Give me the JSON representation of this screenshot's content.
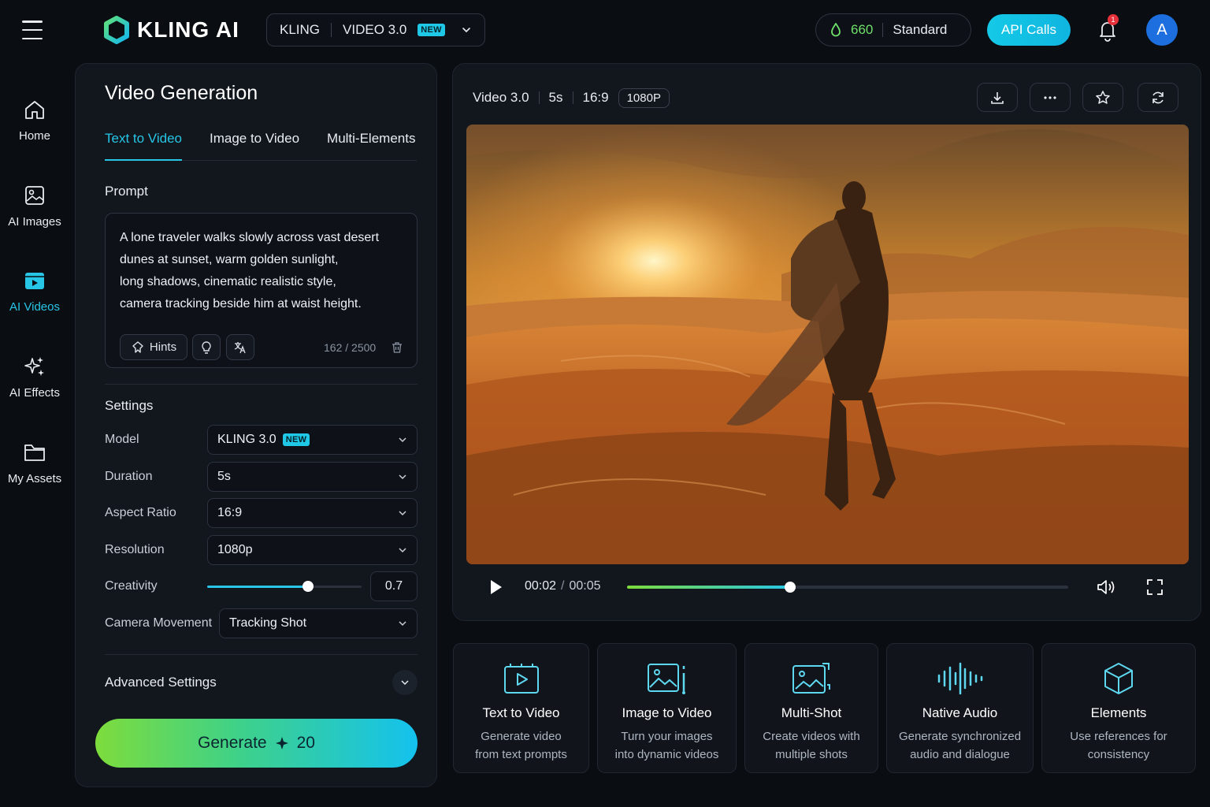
{
  "header": {
    "brand": "KLING AI",
    "model_switch": {
      "provider": "KLING",
      "version": "VIDEO 3.0",
      "badge": "NEW"
    },
    "credits": {
      "amount": "660",
      "plan": "Standard"
    },
    "api_button": "API Calls",
    "notification_count": "1",
    "avatar_initial": "A"
  },
  "sidebar": {
    "items": [
      {
        "label": "Home",
        "icon": "home-icon"
      },
      {
        "label": "AI Images",
        "icon": "image-icon"
      },
      {
        "label": "AI Videos",
        "icon": "video-icon",
        "active": true
      },
      {
        "label": "AI Effects",
        "icon": "sparkles-icon"
      },
      {
        "label": "My Assets",
        "icon": "folder-icon"
      }
    ]
  },
  "panel": {
    "title": "Video Generation",
    "tabs": [
      {
        "label": "Text to Video",
        "active": true
      },
      {
        "label": "Image to Video"
      },
      {
        "label": "Multi-Elements"
      }
    ],
    "prompt_label": "Prompt",
    "prompt_text": "A lone traveler walks slowly across vast desert\ndunes at sunset, warm golden sunlight,\nlong shadows, cinematic realistic style,\ncamera tracking beside him at waist height.",
    "hints_label": "Hints",
    "char_count": "162 / 2500",
    "settings_label": "Settings",
    "settings": {
      "model": {
        "label": "Model",
        "value": "KLING 3.0",
        "badge": "NEW"
      },
      "duration": {
        "label": "Duration",
        "value": "5s"
      },
      "aspect_ratio": {
        "label": "Aspect Ratio",
        "value": "16:9"
      },
      "resolution": {
        "label": "Resolution",
        "value": "1080p"
      },
      "creativity": {
        "label": "Creativity",
        "value": "0.7"
      },
      "camera_movement": {
        "label": "Camera Movement",
        "value": "Tracking Shot"
      }
    },
    "advanced_label": "Advanced Settings",
    "generate": {
      "label": "Generate",
      "cost": "20"
    }
  },
  "preview": {
    "meta": {
      "model": "Video 3.0",
      "duration": "5s",
      "ratio": "16:9",
      "resolution": "1080P"
    },
    "player": {
      "current": "00:02",
      "separator": "/",
      "total": "00:05",
      "progress": 0.37
    }
  },
  "features": [
    {
      "title": "Text to Video",
      "desc": "Generate video\nfrom text prompts",
      "icon": "text-to-video-icon"
    },
    {
      "title": "Image to Video",
      "desc": "Turn your images\ninto dynamic videos",
      "icon": "image-to-video-icon"
    },
    {
      "title": "Multi-Shot",
      "desc": "Create videos with\nmultiple shots",
      "icon": "multi-shot-icon"
    },
    {
      "title": "Native Audio",
      "desc": "Generate synchronized\naudio and dialogue",
      "icon": "audio-wave-icon"
    },
    {
      "title": "Elements",
      "desc": "Use references for\nconsistency",
      "icon": "cube-icon"
    }
  ],
  "colors": {
    "accent": "#27c6e6",
    "background": "#0a0d12",
    "panel": "#12161d",
    "credit_green": "#6ee06a"
  }
}
